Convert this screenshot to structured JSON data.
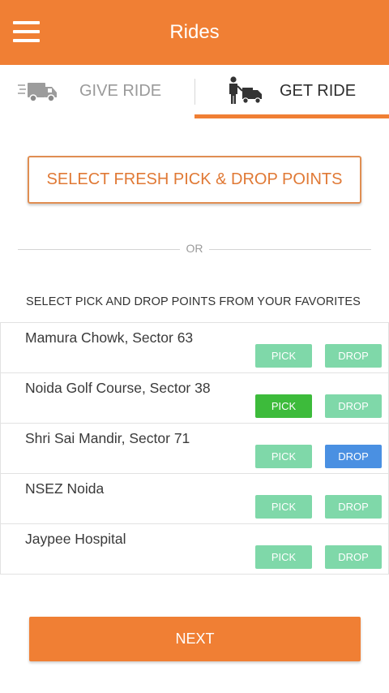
{
  "appbar": {
    "title": "Rides",
    "menu_icon": "hamburger-menu-icon",
    "background": "#f07f34"
  },
  "tabs": [
    {
      "label": "GIVE RIDE",
      "icon": "delivery-truck-icon",
      "active": false
    },
    {
      "label": "GET RIDE",
      "icon": "person-with-truck-icon",
      "active": true
    }
  ],
  "fresh_points": {
    "label": "SELECT FRESH PICK & DROP POINTS"
  },
  "separator": {
    "text": "OR"
  },
  "favorites": {
    "heading": "SELECT PICK AND DROP POINTS FROM YOUR FAVORITES",
    "pick_label": "PICK",
    "drop_label": "DROP",
    "colors": {
      "inactive": "#7fd8a9",
      "pick_selected": "#3dbb3b",
      "drop_selected": "#4a90e2"
    },
    "items": [
      {
        "name": "Mamura Chowk, Sector 63",
        "pick_selected": false,
        "drop_selected": false
      },
      {
        "name": "Noida Golf Course, Sector 38",
        "pick_selected": true,
        "drop_selected": false
      },
      {
        "name": "Shri Sai Mandir, Sector 71",
        "pick_selected": false,
        "drop_selected": true
      },
      {
        "name": "NSEZ Noida",
        "pick_selected": false,
        "drop_selected": false
      },
      {
        "name": "Jaypee Hospital",
        "pick_selected": false,
        "drop_selected": false
      }
    ]
  },
  "next": {
    "label": "NEXT"
  }
}
